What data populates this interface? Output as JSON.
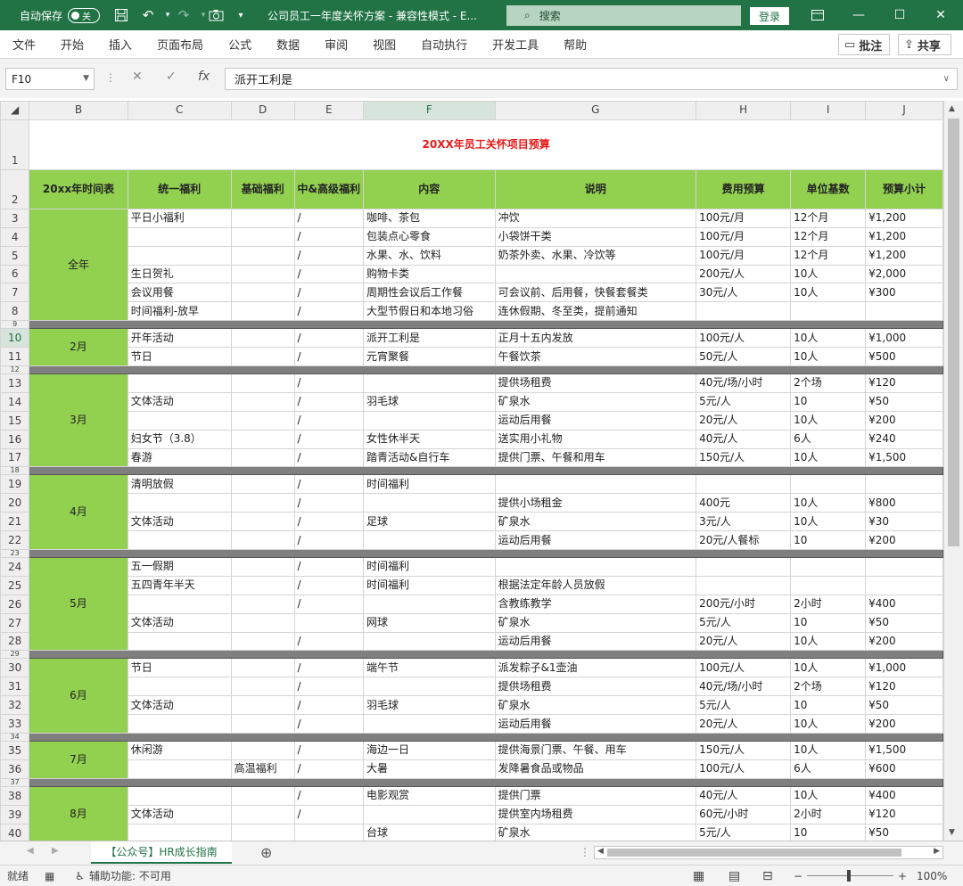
{
  "titlebar": {
    "autosave": "自动保存",
    "toggle": "关",
    "doc_title": "公司员工一年度关怀方案 - 兼容性模式 - E...",
    "search": "搜索",
    "login": "登录"
  },
  "menu": [
    "文件",
    "开始",
    "插入",
    "页面布局",
    "公式",
    "数据",
    "审阅",
    "视图",
    "自动执行",
    "开发工具",
    "帮助"
  ],
  "menu_right": {
    "comment": "批注",
    "share": "共享"
  },
  "formula": {
    "cell": "F10",
    "value": "派开工利是"
  },
  "columns": [
    "B",
    "C",
    "D",
    "E",
    "F",
    "G",
    "H",
    "I",
    "J"
  ],
  "sheet_title": "20XX年员工关怀项目预算",
  "headers": [
    "20xx年时间表",
    "统一福利",
    "基础福利",
    "中&高级福利",
    "内容",
    "说明",
    "费用预算",
    "单位基数",
    "预算小计"
  ],
  "rows": [
    {
      "n": "3",
      "c": "平日小福利",
      "d": "",
      "e": "/",
      "f": "咖啡、茶包",
      "g": "冲饮",
      "h": "100元/月",
      "i": "12个月",
      "j": "¥1,200"
    },
    {
      "n": "4",
      "c": "",
      "d": "",
      "e": "/",
      "f": "包装点心零食",
      "g": "小袋饼干类",
      "h": "100元/月",
      "i": "12个月",
      "j": "¥1,200"
    },
    {
      "n": "5",
      "c": "",
      "d": "",
      "e": "/",
      "f": "水果、水、饮料",
      "g": "奶茶外卖、水果、冷饮等",
      "h": "100元/月",
      "i": "12个月",
      "j": "¥1,200"
    },
    {
      "n": "6",
      "c": "生日贺礼",
      "d": "",
      "e": "/",
      "f": "购物卡类",
      "g": "",
      "h": "200元/人",
      "i": "10人",
      "j": "¥2,000"
    },
    {
      "n": "7",
      "c": "会议用餐",
      "d": "",
      "e": "/",
      "f": "周期性会议后工作餐",
      "g": "可会议前、后用餐，快餐套餐类",
      "h": "30元/人",
      "i": "10人",
      "j": "¥300"
    },
    {
      "n": "8",
      "c": "时间福利-放早",
      "d": "",
      "e": "/",
      "f": "大型节假日和本地习俗",
      "g": "连休假期、冬至类，提前通知",
      "h": "",
      "i": "",
      "j": ""
    },
    {
      "n": "9",
      "sep": true
    },
    {
      "n": "10",
      "c": "开年活动",
      "d": "",
      "e": "/",
      "f": "派开工利是",
      "g": "正月十五内发放",
      "h": "100元/人",
      "i": "10人",
      "j": "¥1,000"
    },
    {
      "n": "11",
      "c": "节日",
      "d": "",
      "e": "/",
      "f": "元宵聚餐",
      "g": "午餐饮茶",
      "h": "50元/人",
      "i": "10人",
      "j": "¥500"
    },
    {
      "n": "12",
      "sep": true
    },
    {
      "n": "13",
      "c": "",
      "d": "",
      "e": "/",
      "f": "",
      "g": "提供场租费",
      "h": "40元/场/小时",
      "i": "2个场",
      "j": "¥120"
    },
    {
      "n": "14",
      "c": "文体活动",
      "d": "",
      "e": "/",
      "f": "羽毛球",
      "g": "矿泉水",
      "h": "5元/人",
      "i": "10",
      "j": "¥50"
    },
    {
      "n": "15",
      "c": "",
      "d": "",
      "e": "/",
      "f": "",
      "g": "运动后用餐",
      "h": "20元/人",
      "i": "10人",
      "j": "¥200"
    },
    {
      "n": "16",
      "c": "妇女节（3.8）",
      "d": "",
      "e": "/",
      "f": "女性休半天",
      "g": "送实用小礼物",
      "h": "40元/人",
      "i": "6人",
      "j": "¥240"
    },
    {
      "n": "17",
      "c": "春游",
      "d": "",
      "e": "/",
      "f": "踏青活动&自行车",
      "g": "提供门票、午餐和用车",
      "h": "150元/人",
      "i": "10人",
      "j": "¥1,500"
    },
    {
      "n": "18",
      "sep": true
    },
    {
      "n": "19",
      "c": "清明放假",
      "d": "",
      "e": "/",
      "f": "时间福利",
      "g": "",
      "h": "",
      "i": "",
      "j": ""
    },
    {
      "n": "20",
      "c": "",
      "d": "",
      "e": "/",
      "f": "",
      "g": "提供小场租金",
      "h": "400元",
      "i": "10人",
      "j": "¥800"
    },
    {
      "n": "21",
      "c": "文体活动",
      "d": "",
      "e": "/",
      "f": "足球",
      "g": "矿泉水",
      "h": "3元/人",
      "i": "10人",
      "j": "¥30"
    },
    {
      "n": "22",
      "c": "",
      "d": "",
      "e": "/",
      "f": "",
      "g": "运动后用餐",
      "h": "20元/人餐标",
      "i": "10",
      "j": "¥200"
    },
    {
      "n": "23",
      "sep": true
    },
    {
      "n": "24",
      "c": "五一假期",
      "d": "",
      "e": "/",
      "f": "时间福利",
      "g": "",
      "h": "",
      "i": "",
      "j": ""
    },
    {
      "n": "25",
      "c": "五四青年半天",
      "d": "",
      "e": "/",
      "f": "时间福利",
      "g": "根据法定年龄人员放假",
      "h": "",
      "i": "",
      "j": ""
    },
    {
      "n": "26",
      "c": "",
      "d": "",
      "e": "/",
      "f": "",
      "g": "含教练教学",
      "h": "200元/小时",
      "i": "2小时",
      "j": "¥400"
    },
    {
      "n": "27",
      "c": "文体活动",
      "d": "",
      "e": "",
      "f": "网球",
      "g": "矿泉水",
      "h": "5元/人",
      "i": "10",
      "j": "¥50"
    },
    {
      "n": "28",
      "c": "",
      "d": "",
      "e": "/",
      "f": "",
      "g": "运动后用餐",
      "h": "20元/人",
      "i": "10人",
      "j": "¥200"
    },
    {
      "n": "29",
      "sep": true
    },
    {
      "n": "30",
      "c": "节日",
      "d": "",
      "e": "/",
      "f": "端午节",
      "g": "派发粽子&1壶油",
      "h": "100元/人",
      "i": "10人",
      "j": "¥1,000"
    },
    {
      "n": "31",
      "c": "",
      "d": "",
      "e": "/",
      "f": "",
      "g": "提供场租费",
      "h": "40元/场/小时",
      "i": "2个场",
      "j": "¥120"
    },
    {
      "n": "32",
      "c": "文体活动",
      "d": "",
      "e": "/",
      "f": "羽毛球",
      "g": "矿泉水",
      "h": "5元/人",
      "i": "10",
      "j": "¥50"
    },
    {
      "n": "33",
      "c": "",
      "d": "",
      "e": "/",
      "f": "",
      "g": "运动后用餐",
      "h": "20元/人",
      "i": "10人",
      "j": "¥200"
    },
    {
      "n": "34",
      "sep": true
    },
    {
      "n": "35",
      "c": "休闲游",
      "d": "",
      "e": "/",
      "f": "海边一日",
      "g": "提供海景门票、午餐、用车",
      "h": "150元/人",
      "i": "10人",
      "j": "¥1,500"
    },
    {
      "n": "36",
      "c": "",
      "d": "高温福利",
      "e": "/",
      "f": "大暑",
      "g": "发降暑食品或物品",
      "h": "100元/人",
      "i": "6人",
      "j": "¥600"
    },
    {
      "n": "37",
      "sep": true
    },
    {
      "n": "38",
      "c": "",
      "d": "",
      "e": "/",
      "f": "电影观赏",
      "g": "提供门票",
      "h": "40元/人",
      "i": "10人",
      "j": "¥400"
    },
    {
      "n": "39",
      "c": "文体活动",
      "d": "",
      "e": "/",
      "f": "",
      "g": "提供室内场租费",
      "h": "60元/小时",
      "i": "2小时",
      "j": "¥120"
    },
    {
      "n": "40",
      "c": "",
      "d": "",
      "e": "",
      "f": "台球",
      "g": "矿泉水",
      "h": "5元/人",
      "i": "10",
      "j": "¥50"
    }
  ],
  "periods": [
    {
      "label": "全年",
      "start": "3",
      "span": 6
    },
    {
      "label": "2月",
      "start": "10",
      "span": 2
    },
    {
      "label": "3月",
      "start": "13",
      "span": 5
    },
    {
      "label": "4月",
      "start": "19",
      "span": 4
    },
    {
      "label": "5月",
      "start": "24",
      "span": 5
    },
    {
      "label": "6月",
      "start": "30",
      "span": 4
    },
    {
      "label": "7月",
      "start": "35",
      "span": 2
    },
    {
      "label": "8月",
      "start": "38",
      "span": 3
    }
  ],
  "sheet_tab": "【公众号】HR成长指南",
  "status": {
    "ready": "就绪",
    "accessibility": "辅助功能: 不可用",
    "zoom": "100%"
  }
}
